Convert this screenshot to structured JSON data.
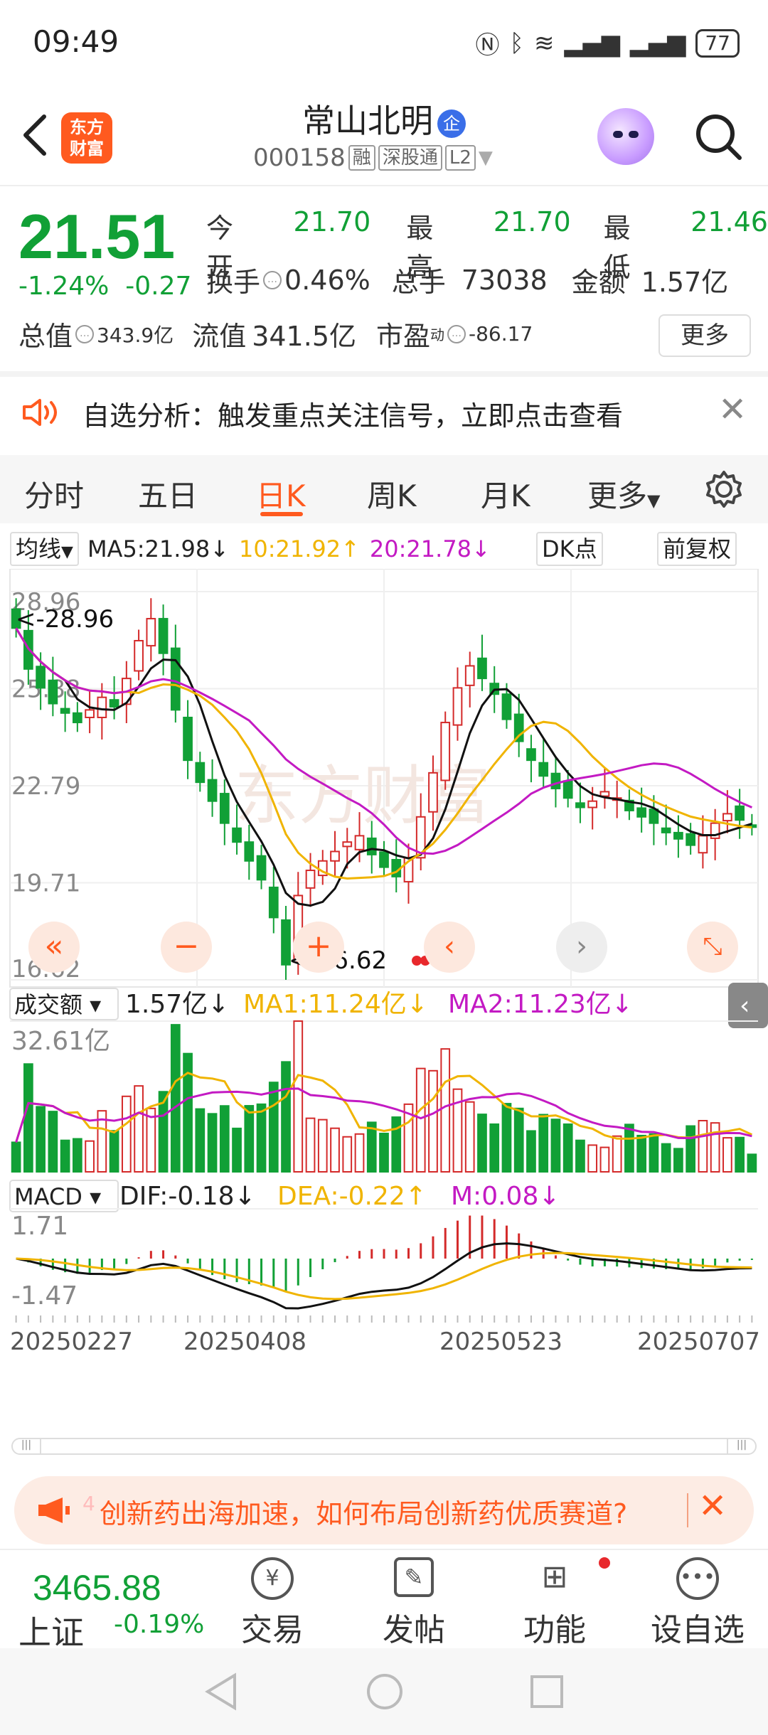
{
  "status": {
    "time": "09:49",
    "battery": "77"
  },
  "header": {
    "name": "常山北明",
    "badge": "企",
    "code": "000158",
    "tags": [
      "融",
      "深股通",
      "L2"
    ],
    "logo": "东方财富"
  },
  "quote": {
    "price": "21.51",
    "pct": "-1.24%",
    "chg": "-0.27",
    "open_label": "今开",
    "open": "21.70",
    "high_label": "最高",
    "high": "21.70",
    "low_label": "最低",
    "low": "21.46",
    "turnover_label": "换手",
    "turnover": "0.46%",
    "vol_label": "总手",
    "vol": "73038",
    "amount_label": "金额",
    "amount": "1.57亿",
    "mcap_label": "总值",
    "mcap": "343.9亿",
    "float_label": "流值",
    "float": "341.5亿",
    "pe_label": "市盈",
    "pe_sup": "动",
    "pe": "-86.17",
    "more": "更多"
  },
  "alert": {
    "text": "自选分析：触发重点关注信号，立即点击查看"
  },
  "tabs": [
    "分时",
    "五日",
    "日K",
    "周K",
    "月K",
    "更多"
  ],
  "ma": {
    "label": "均线",
    "ma5": "MA5:21.98↓",
    "ma10": "10:21.92↑",
    "ma20": "20:21.78↓",
    "dk": "DK点",
    "fq": "前复权"
  },
  "kline": {
    "y_ticks": [
      "28.96",
      "25.88",
      "22.79",
      "19.71",
      "16.62"
    ],
    "high_mark": "<-28.96",
    "low_mark": "<-16.62"
  },
  "volume": {
    "label": "成交额",
    "value": "1.57亿↓",
    "ma1": "MA1:11.24亿↓",
    "ma2": "MA2:11.23亿↓",
    "max": "32.61亿"
  },
  "macd": {
    "label": "MACD",
    "dif": "DIF:-0.18↓",
    "dea": "DEA:-0.22↑",
    "m": "M:0.08↓",
    "top": "1.71",
    "bottom": "-1.47"
  },
  "dates": [
    "20250227",
    "20250408",
    "20250523",
    "20250707"
  ],
  "ad": {
    "text": "创新药出海加速，如何布局创新药优质赛道?",
    "prefix": "4"
  },
  "bottom": {
    "index_value": "3465.88",
    "index_name": "上证",
    "index_pct": "-0.19%",
    "items": [
      "交易",
      "发帖",
      "功能",
      "设自选"
    ]
  },
  "colors": {
    "up": "#d42a2a",
    "down": "#11a036",
    "accent": "#ff5a1f",
    "ma10": "#f0b400",
    "ma20": "#c31ac3"
  },
  "chart_data": {
    "type": "candlestick",
    "y_range": [
      16.62,
      28.96
    ],
    "closes": [
      27.8,
      26.5,
      25.9,
      25.4,
      25.1,
      24.8,
      25.2,
      25.6,
      25.3,
      26.2,
      27.4,
      28.1,
      27.0,
      25.2,
      23.6,
      22.9,
      22.3,
      21.6,
      21.0,
      20.4,
      19.8,
      18.6,
      17.1,
      19.3,
      20.1,
      20.4,
      20.7,
      21.0,
      21.2,
      20.6,
      20.2,
      19.9,
      20.5,
      21.8,
      23.2,
      24.8,
      25.9,
      26.6,
      26.2,
      25.7,
      24.9,
      24.2,
      23.6,
      23.1,
      22.7,
      22.4,
      22.1,
      22.3,
      22.6,
      22.4,
      22.0,
      21.8,
      21.6,
      21.3,
      21.1,
      20.9,
      21.2,
      21.6,
      21.9,
      21.7,
      21.51
    ]
  }
}
